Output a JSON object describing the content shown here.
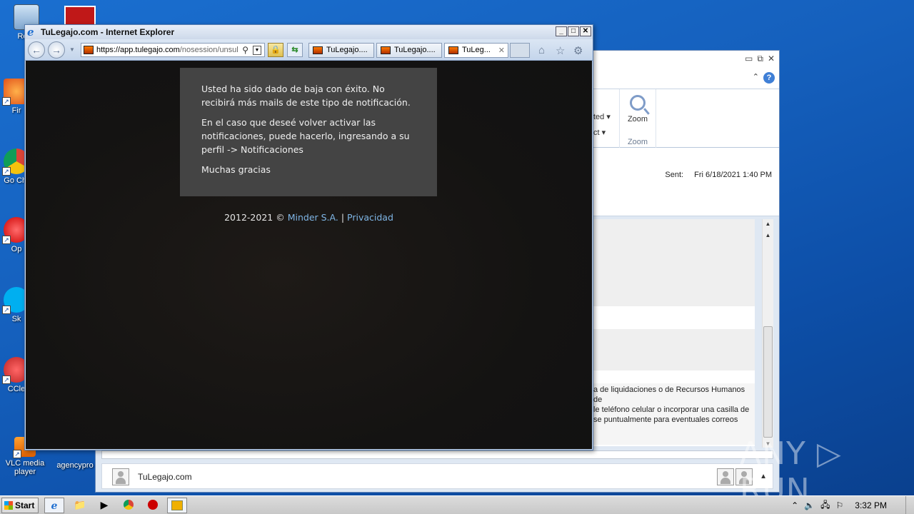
{
  "desktop": {
    "icons": [
      {
        "label": "Recy",
        "name": "recycle-bin"
      },
      {
        "label": "Fir",
        "name": "firefox"
      },
      {
        "label": "Go Chr",
        "name": "chrome"
      },
      {
        "label": "Op",
        "name": "opera"
      },
      {
        "label": "Sk",
        "name": "skype"
      },
      {
        "label": "CCle",
        "name": "ccleaner"
      },
      {
        "label": "VLC media player",
        "name": "vlc"
      },
      {
        "label": "agencypro",
        "name": "agencypro"
      }
    ],
    "watermark": "ANY ▷ RUN"
  },
  "ie": {
    "title": "TuLegajo.com - Internet Explorer",
    "address": {
      "scheme_host": "https://app.tulegajo.com",
      "path": "/nosession/unsul"
    },
    "tabs": [
      {
        "label": "TuLegajo...."
      },
      {
        "label": "TuLegajo...."
      },
      {
        "label": "TuLeg..."
      }
    ],
    "page": {
      "msg1": "Usted ha sido dado de baja con éxito. No recibirá más mails de este tipo de notificación.",
      "msg2": "En el caso que deseé volver activar las notificaciones, puede hacerlo, ingresando a su perfil -> Notificaciones",
      "msg3": "Muchas gracias",
      "footer_prefix": "2012-2021 © ",
      "footer_link1": "Minder S.A.",
      "footer_sep": " | ",
      "footer_link2": "Privacidad"
    }
  },
  "outlook": {
    "ribbon_frag1": "ted",
    "ribbon_frag2": "ct",
    "zoom_label": "Zoom",
    "zoom_group": "Zoom",
    "sent_label": "Sent:",
    "sent_value": "Fri 6/18/2021 1:40 PM",
    "body_lines": [
      "a de liquidaciones o de Recursos Humanos de",
      "le teléfono celular o incorporar una casilla de",
      "se puntualmente para eventuales correos"
    ],
    "sender": "TuLegajo.com"
  },
  "taskbar": {
    "start": "Start",
    "clock": "3:32 PM"
  }
}
